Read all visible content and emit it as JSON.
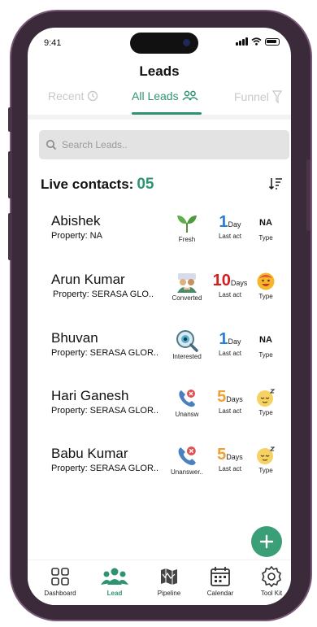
{
  "status_bar": {
    "time": "9:41"
  },
  "header": {
    "title": "Leads"
  },
  "tabs": [
    {
      "label": "Recent",
      "icon": "history-icon"
    },
    {
      "label": "All Leads",
      "icon": "users-icon"
    },
    {
      "label": "Funnel",
      "icon": "funnel-icon"
    }
  ],
  "search": {
    "placeholder": "Search Leads.."
  },
  "live_contacts": {
    "label": "Live contacts:",
    "count": "05"
  },
  "leads": [
    {
      "name": "Abishek",
      "property": "Property: NA",
      "stage": "Fresh",
      "stage_icon": "sprout-icon",
      "last_act_value": "1",
      "last_act_unit": "Day",
      "last_act_label": "Last act",
      "last_act_color": "#2b7fd4",
      "type_value": "NA",
      "type_label": "Type"
    },
    {
      "name": "Arun Kumar",
      "property": "Property: SERASA GLO..",
      "stage": "Converted",
      "stage_icon": "handshake-icon",
      "last_act_value": "10",
      "last_act_unit": "Days",
      "last_act_label": "Last act",
      "last_act_color": "#d41e1e",
      "type_value": "",
      "type_label": "Type"
    },
    {
      "name": "Bhuvan",
      "property": "Property: SERASA GLOR..",
      "stage": "Interested",
      "stage_icon": "magnifier-eye-icon",
      "last_act_value": "1",
      "last_act_unit": "Day",
      "last_act_label": "Last act",
      "last_act_color": "#2b7fd4",
      "type_value": "NA",
      "type_label": "Type"
    },
    {
      "name": "Hari Ganesh",
      "property": "Property: SERASA GLOR..",
      "stage": "Unansw",
      "stage_icon": "missed-call-icon",
      "last_act_value": "5",
      "last_act_unit": "Days",
      "last_act_label": "Last act",
      "last_act_color": "#f0a030",
      "type_value": "",
      "type_label": "Type"
    },
    {
      "name": "Babu Kumar",
      "property": "Property: SERASA GLOR..",
      "stage": "Unanswer..",
      "stage_icon": "missed-call-icon",
      "last_act_value": "5",
      "last_act_unit": "Days",
      "last_act_label": "Last act",
      "last_act_color": "#f0a030",
      "type_value": "",
      "type_label": "Type"
    }
  ],
  "bottom_nav": [
    {
      "label": "Dashboard",
      "icon": "dashboard-icon"
    },
    {
      "label": "Lead",
      "icon": "lead-group-icon"
    },
    {
      "label": "Pipeline",
      "icon": "pipeline-map-icon"
    },
    {
      "label": "Calendar",
      "icon": "calendar-icon"
    },
    {
      "label": "Tool Kit",
      "icon": "gear-icon"
    }
  ],
  "colors": {
    "accent": "#2e9470",
    "fab": "#3a9e77"
  }
}
